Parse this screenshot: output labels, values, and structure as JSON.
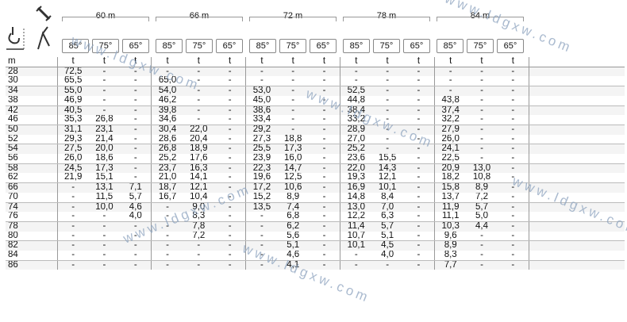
{
  "header": {
    "groups": [
      "60 m",
      "66 m",
      "72 m",
      "78 m",
      "84 m"
    ],
    "angles": [
      "85°",
      "75°",
      "65°"
    ],
    "icons": [
      "boom-wrench-icon",
      "hook-icon",
      "jib-luffing-icon"
    ]
  },
  "table": {
    "unit_row": [
      "m",
      "t",
      "t",
      "t",
      "t",
      "t",
      "t",
      "t",
      "t",
      "t",
      "t",
      "t",
      "t",
      "t",
      "t",
      "t"
    ],
    "rows": [
      [
        "28",
        "72,5",
        "-",
        "-",
        "-",
        "-",
        "-",
        "-",
        "-",
        "-",
        "-",
        "-",
        "-",
        "-",
        "-",
        "-"
      ],
      [
        "30",
        "65,5",
        "-",
        "-",
        "65,0",
        "-",
        "-",
        "-",
        "-",
        "-",
        "-",
        "-",
        "-",
        "-",
        "-",
        "-"
      ],
      [
        "34",
        "55,0",
        "-",
        "-",
        "54,0",
        "-",
        "-",
        "53,0",
        "-",
        "-",
        "52,5",
        "-",
        "-",
        "-",
        "-",
        "-"
      ],
      [
        "38",
        "46,9",
        "-",
        "-",
        "46,2",
        "-",
        "-",
        "45,0",
        "-",
        "-",
        "44,8",
        "-",
        "-",
        "43,8",
        "-",
        "-"
      ],
      [
        "42",
        "40,5",
        "-",
        "-",
        "39,8",
        "-",
        "-",
        "38,6",
        "-",
        "-",
        "38,4",
        "-",
        "-",
        "37,4",
        "-",
        "-"
      ],
      [
        "46",
        "35,3",
        "26,8",
        "-",
        "34,6",
        "-",
        "-",
        "33,4",
        "-",
        "-",
        "33,2",
        "-",
        "-",
        "32,2",
        "-",
        "-"
      ],
      [
        "50",
        "31,1",
        "23,1",
        "-",
        "30,4",
        "22,0",
        "-",
        "29,2",
        "-",
        "-",
        "28,9",
        "-",
        "-",
        "27,9",
        "-",
        "-"
      ],
      [
        "52",
        "29,3",
        "21,4",
        "-",
        "28,6",
        "20,4",
        "-",
        "27,3",
        "18,8",
        "-",
        "27,0",
        "-",
        "-",
        "26,0",
        "-",
        "-"
      ],
      [
        "54",
        "27,5",
        "20,0",
        "-",
        "26,8",
        "18,9",
        "-",
        "25,5",
        "17,3",
        "-",
        "25,2",
        "-",
        "-",
        "24,1",
        "-",
        "-"
      ],
      [
        "56",
        "26,0",
        "18,6",
        "-",
        "25,2",
        "17,6",
        "-",
        "23,9",
        "16,0",
        "-",
        "23,6",
        "15,5",
        "-",
        "22,5",
        "-",
        "-"
      ],
      [
        "58",
        "24,5",
        "17,3",
        "-",
        "23,7",
        "16,3",
        "-",
        "22,3",
        "14,7",
        "-",
        "22,0",
        "14,3",
        "-",
        "20,9",
        "13,0",
        "-"
      ],
      [
        "62",
        "21,9",
        "15,1",
        "-",
        "21,0",
        "14,1",
        "-",
        "19,6",
        "12,5",
        "-",
        "19,3",
        "12,1",
        "-",
        "18,2",
        "10,8",
        "-"
      ],
      [
        "66",
        "-",
        "13,1",
        "7,1",
        "18,7",
        "12,1",
        "-",
        "17,2",
        "10,6",
        "-",
        "16,9",
        "10,1",
        "-",
        "15,8",
        "8,9",
        "-"
      ],
      [
        "70",
        "-",
        "11,5",
        "5,7",
        "16,7",
        "10,4",
        "-",
        "15,2",
        "8,9",
        "-",
        "14,8",
        "8,4",
        "-",
        "13,7",
        "7,2",
        "-"
      ],
      [
        "74",
        "-",
        "10,0",
        "4,6",
        "-",
        "9,0",
        "-",
        "13,5",
        "7,4",
        "-",
        "13,0",
        "7,0",
        "-",
        "11,9",
        "5,7",
        "-"
      ],
      [
        "76",
        "-",
        "-",
        "4,0",
        "-",
        "8,3",
        "-",
        "-",
        "6,8",
        "-",
        "12,2",
        "6,3",
        "-",
        "11,1",
        "5,0",
        "-"
      ],
      [
        "78",
        "-",
        "-",
        "-",
        "-",
        "7,8",
        "-",
        "-",
        "6,2",
        "-",
        "11,4",
        "5,7",
        "-",
        "10,3",
        "4,4",
        "-"
      ],
      [
        "80",
        "-",
        "-",
        "-",
        "-",
        "7,2",
        "-",
        "-",
        "5,6",
        "-",
        "10,7",
        "5,1",
        "-",
        "9,6",
        "-",
        "-"
      ],
      [
        "82",
        "-",
        "-",
        "-",
        "-",
        "-",
        "-",
        "-",
        "5,1",
        "-",
        "10,1",
        "4,5",
        "-",
        "8,9",
        "-",
        "-"
      ],
      [
        "84",
        "-",
        "-",
        "-",
        "-",
        "-",
        "-",
        "-",
        "4,6",
        "-",
        "-",
        "4,0",
        "-",
        "8,3",
        "-",
        "-"
      ],
      [
        "86",
        "-",
        "-",
        "-",
        "-",
        "-",
        "-",
        "-",
        "4,1",
        "-",
        "-",
        "-",
        "-",
        "7,7",
        "-",
        "-"
      ]
    ]
  },
  "watermark": "www.ldgxw.com"
}
